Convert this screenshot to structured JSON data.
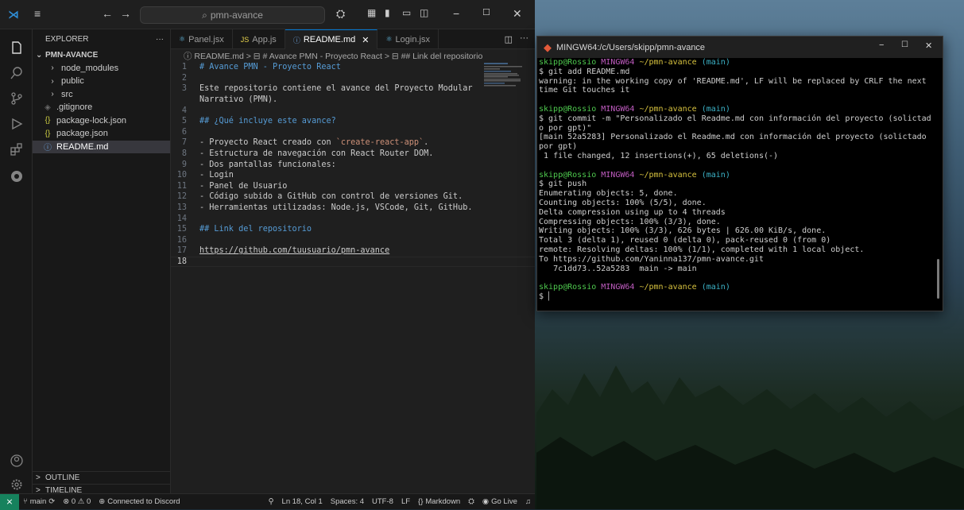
{
  "vscode": {
    "search_text": "pmn-avance",
    "explorer_title": "EXPLORER",
    "project_name": "PMN-AVANCE",
    "tree": [
      {
        "label": "node_modules",
        "kind": "folder"
      },
      {
        "label": "public",
        "kind": "folder"
      },
      {
        "label": "src",
        "kind": "folder"
      },
      {
        "label": ".gitignore",
        "kind": "git"
      },
      {
        "label": "package-lock.json",
        "kind": "json"
      },
      {
        "label": "package.json",
        "kind": "json"
      },
      {
        "label": "README.md",
        "kind": "info"
      }
    ],
    "outline_label": "OUTLINE",
    "timeline_label": "TIMELINE",
    "tabs": [
      {
        "label": "Panel.jsx",
        "icon": "⚛"
      },
      {
        "label": "App.js",
        "icon": "JS"
      },
      {
        "label": "README.md",
        "icon": "ⓘ"
      },
      {
        "label": "Login.jsx",
        "icon": "⚛"
      }
    ],
    "breadcrumb": "ⓘ README.md > ⊟ # Avance PMN - Proyecto React > ⊟ ## Link del repositorio",
    "lines": [
      "# Avance PMN - Proyecto React",
      "",
      "Este repositorio contiene el avance del Proyecto Modular",
      "Narrativo (PMN).",
      "",
      "## ¿Qué incluye este avance?",
      "",
      "- Proyecto React creado con `create-react-app`.",
      "- Estructura de navegación con React Router DOM.",
      "- Dos pantallas funcionales:",
      "  - Login",
      "  - Panel de Usuario",
      "- Código subido a GitHub con control de versiones Git.",
      "- Herramientas utilizadas: Node.js, VSCode, Git, GitHub.",
      "",
      "## Link del repositorio",
      "",
      "https://github.com/tuusuario/pmn-avance",
      ""
    ],
    "line_numbers": [
      "1",
      "2",
      "3",
      "",
      "4",
      "5",
      "6",
      "7",
      "8",
      "9",
      "10",
      "11",
      "12",
      "13",
      "14",
      "15",
      "16",
      "17",
      "18"
    ],
    "status": {
      "branch": "main",
      "problems": "⊗ 0 ⚠ 0",
      "discord": "Connected to Discord",
      "position": "Ln 18, Col 1",
      "spaces": "Spaces: 4",
      "encoding": "UTF-8",
      "eol": "LF",
      "language": "Markdown",
      "golive": "Go Live"
    }
  },
  "terminal": {
    "title": "MINGW64:/c/Users/skipp/pmn-avance",
    "prompt_user": "skipp@Rossio",
    "prompt_env": "MINGW64",
    "prompt_path": "~/pmn-avance",
    "prompt_branch": "(main)",
    "blocks": [
      {
        "cmd": "$ git add README.md",
        "out": "warning: in the working copy of 'README.md', LF will be replaced by CRLF the next time Git touches it"
      },
      {
        "cmd": "$ git commit -m \"Personalizado el Readme.md con información del proyecto (solictado por gpt)\"",
        "out": "[main 52a5283] Personalizado el Readme.md con información del proyecto (solictado por gpt)\n 1 file changed, 12 insertions(+), 65 deletions(-)"
      },
      {
        "cmd": "$ git push",
        "out": "Enumerating objects: 5, done.\nCounting objects: 100% (5/5), done.\nDelta compression using up to 4 threads\nCompressing objects: 100% (3/3), done.\nWriting objects: 100% (3/3), 626 bytes | 626.00 KiB/s, done.\nTotal 3 (delta 1), reused 0 (delta 0), pack-reused 0 (from 0)\nremote: Resolving deltas: 100% (1/1), completed with 1 local object.\nTo https://github.com/Yaninna137/pmn-avance.git\n   7c1dd73..52a5283  main -> main"
      }
    ],
    "final_prompt": "$ "
  }
}
